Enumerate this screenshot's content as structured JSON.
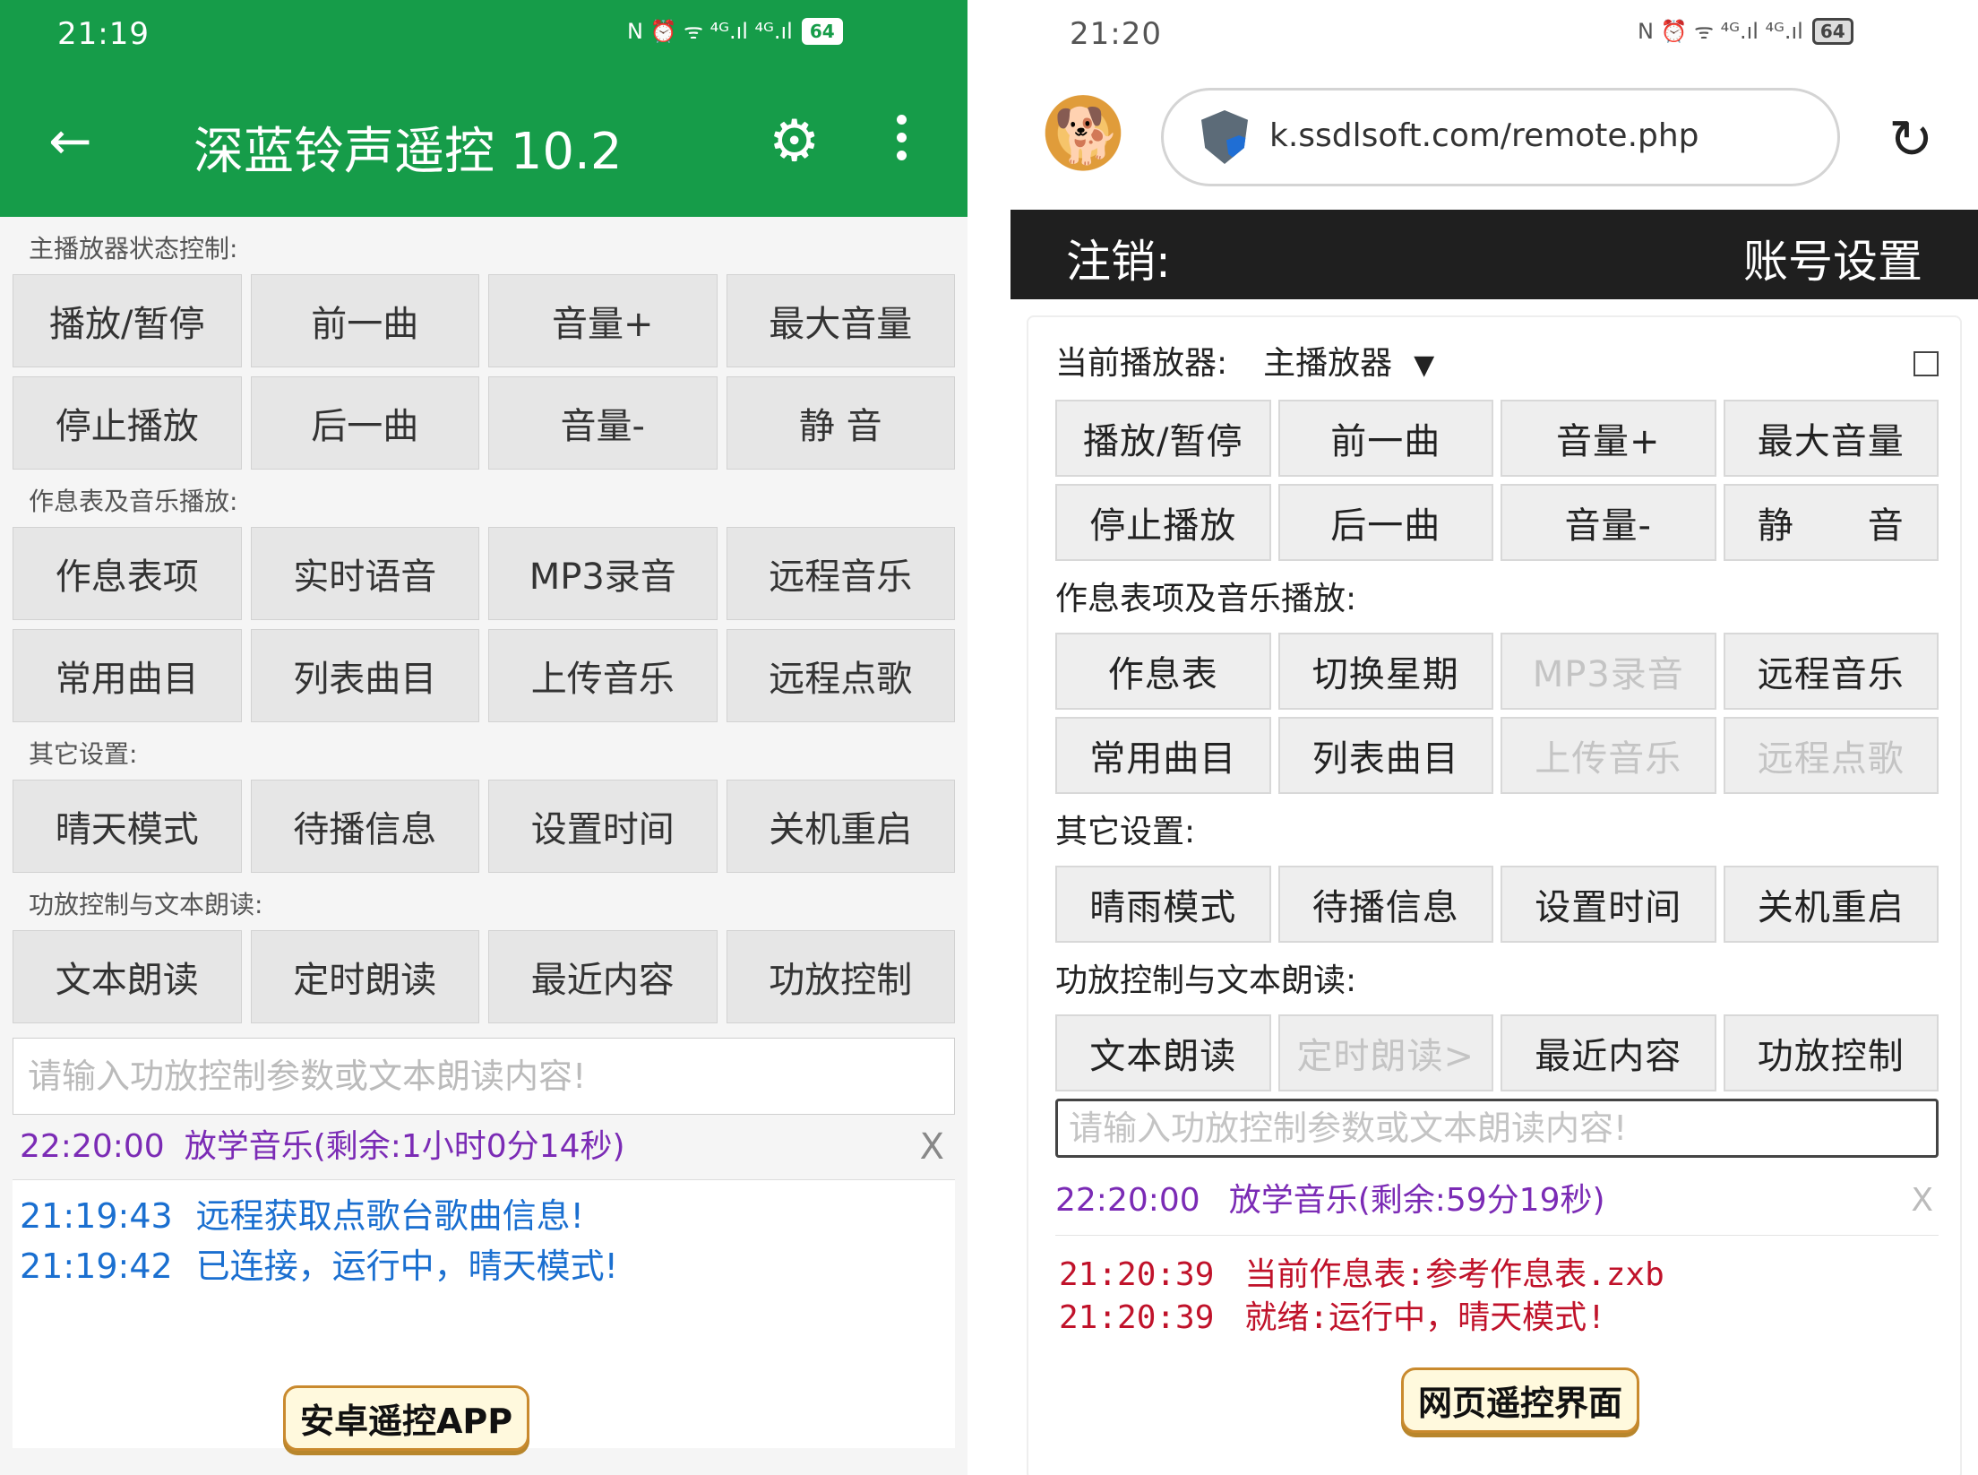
{
  "left_app": {
    "status_time": "21:19",
    "status_icons": "N ⏰ ᯤ ⁴ᴳ.ıl ⁴ᴳ.ıl",
    "battery": "64",
    "title": "深蓝铃声遥控 10.2",
    "sections": [
      {
        "label": "主播放器状态控制:",
        "buttons": [
          "播放/暂停",
          "前一曲",
          "音量+",
          "最大音量",
          "停止播放",
          "后一曲",
          "音量-",
          "静 音"
        ]
      },
      {
        "label": "作息表及音乐播放:",
        "buttons": [
          "作息表项",
          "实时语音",
          "MP3录音",
          "远程音乐",
          "常用曲目",
          "列表曲目",
          "上传音乐",
          "远程点歌"
        ]
      },
      {
        "label": "其它设置:",
        "buttons": [
          "晴天模式",
          "待播信息",
          "设置时间",
          "关机重启"
        ]
      },
      {
        "label": "功放控制与文本朗读:",
        "buttons": [
          "文本朗读",
          "定时朗读",
          "最近内容",
          "功放控制"
        ]
      }
    ],
    "input_placeholder": "请输入功放控制参数或文本朗读内容!",
    "next_time": "22:20:00",
    "next_message": "放学音乐(剩余:1小时0分14秒)",
    "close": "X",
    "log": [
      {
        "time": "21:19:43",
        "message": "远程获取点歌台歌曲信息!"
      },
      {
        "time": "21:19:42",
        "message": "已连接，运行中，晴天模式!"
      }
    ],
    "caption": "安卓遥控APP"
  },
  "right_web": {
    "status_time": "21:20",
    "status_icons": "N ⏰ ᯤ ⁴ᴳ.ıl ⁴ᴳ.ıl",
    "battery": "64",
    "url": "k.ssdlsoft.com/remote.php",
    "logout": "注销:",
    "account_settings": "账号设置",
    "player_label": "当前播放器:",
    "player_value": "主播放器",
    "player_caret": "▼",
    "section1_buttons": [
      {
        "label": "播放/暂停",
        "disabled": false
      },
      {
        "label": "前一曲",
        "disabled": false
      },
      {
        "label": "音量+",
        "disabled": false
      },
      {
        "label": "最大音量",
        "disabled": false
      },
      {
        "label": "停止播放",
        "disabled": false
      },
      {
        "label": "后一曲",
        "disabled": false
      },
      {
        "label": "音量-",
        "disabled": false
      },
      {
        "label": "静　　音",
        "disabled": false
      }
    ],
    "section2_label": "作息表项及音乐播放:",
    "section2_buttons": [
      {
        "label": "作息表",
        "disabled": false
      },
      {
        "label": "切换星期",
        "disabled": false
      },
      {
        "label": "MP3录音",
        "disabled": true
      },
      {
        "label": "远程音乐",
        "disabled": false
      },
      {
        "label": "常用曲目",
        "disabled": false
      },
      {
        "label": "列表曲目",
        "disabled": false
      },
      {
        "label": "上传音乐",
        "disabled": true
      },
      {
        "label": "远程点歌",
        "disabled": true
      }
    ],
    "section3_label": "其它设置:",
    "section3_buttons": [
      {
        "label": "晴雨模式",
        "disabled": false
      },
      {
        "label": "待播信息",
        "disabled": false
      },
      {
        "label": "设置时间",
        "disabled": false
      },
      {
        "label": "关机重启",
        "disabled": false
      }
    ],
    "section4_label": "功放控制与文本朗读:",
    "section4_buttons": [
      {
        "label": "文本朗读",
        "disabled": false
      },
      {
        "label": "定时朗读>",
        "disabled": true
      },
      {
        "label": "最近内容",
        "disabled": false
      },
      {
        "label": "功放控制",
        "disabled": false
      }
    ],
    "input_placeholder": "请输入功放控制参数或文本朗读内容!",
    "next_time": "22:20:00",
    "next_message": "放学音乐(剩余:59分19秒)",
    "close": "X",
    "log": [
      {
        "time": "21:20:39",
        "message": "当前作息表:参考作息表.zxb"
      },
      {
        "time": "21:20:39",
        "message": "就绪:运行中，晴天模式!"
      }
    ],
    "caption": "网页遥控界面"
  },
  "colors": {
    "app_green": "#169c49",
    "status_purple": "#7b2bb5",
    "log_blue": "#1a6fd0",
    "log_red": "#c0122a",
    "topbar_black": "#1f1f1f"
  }
}
